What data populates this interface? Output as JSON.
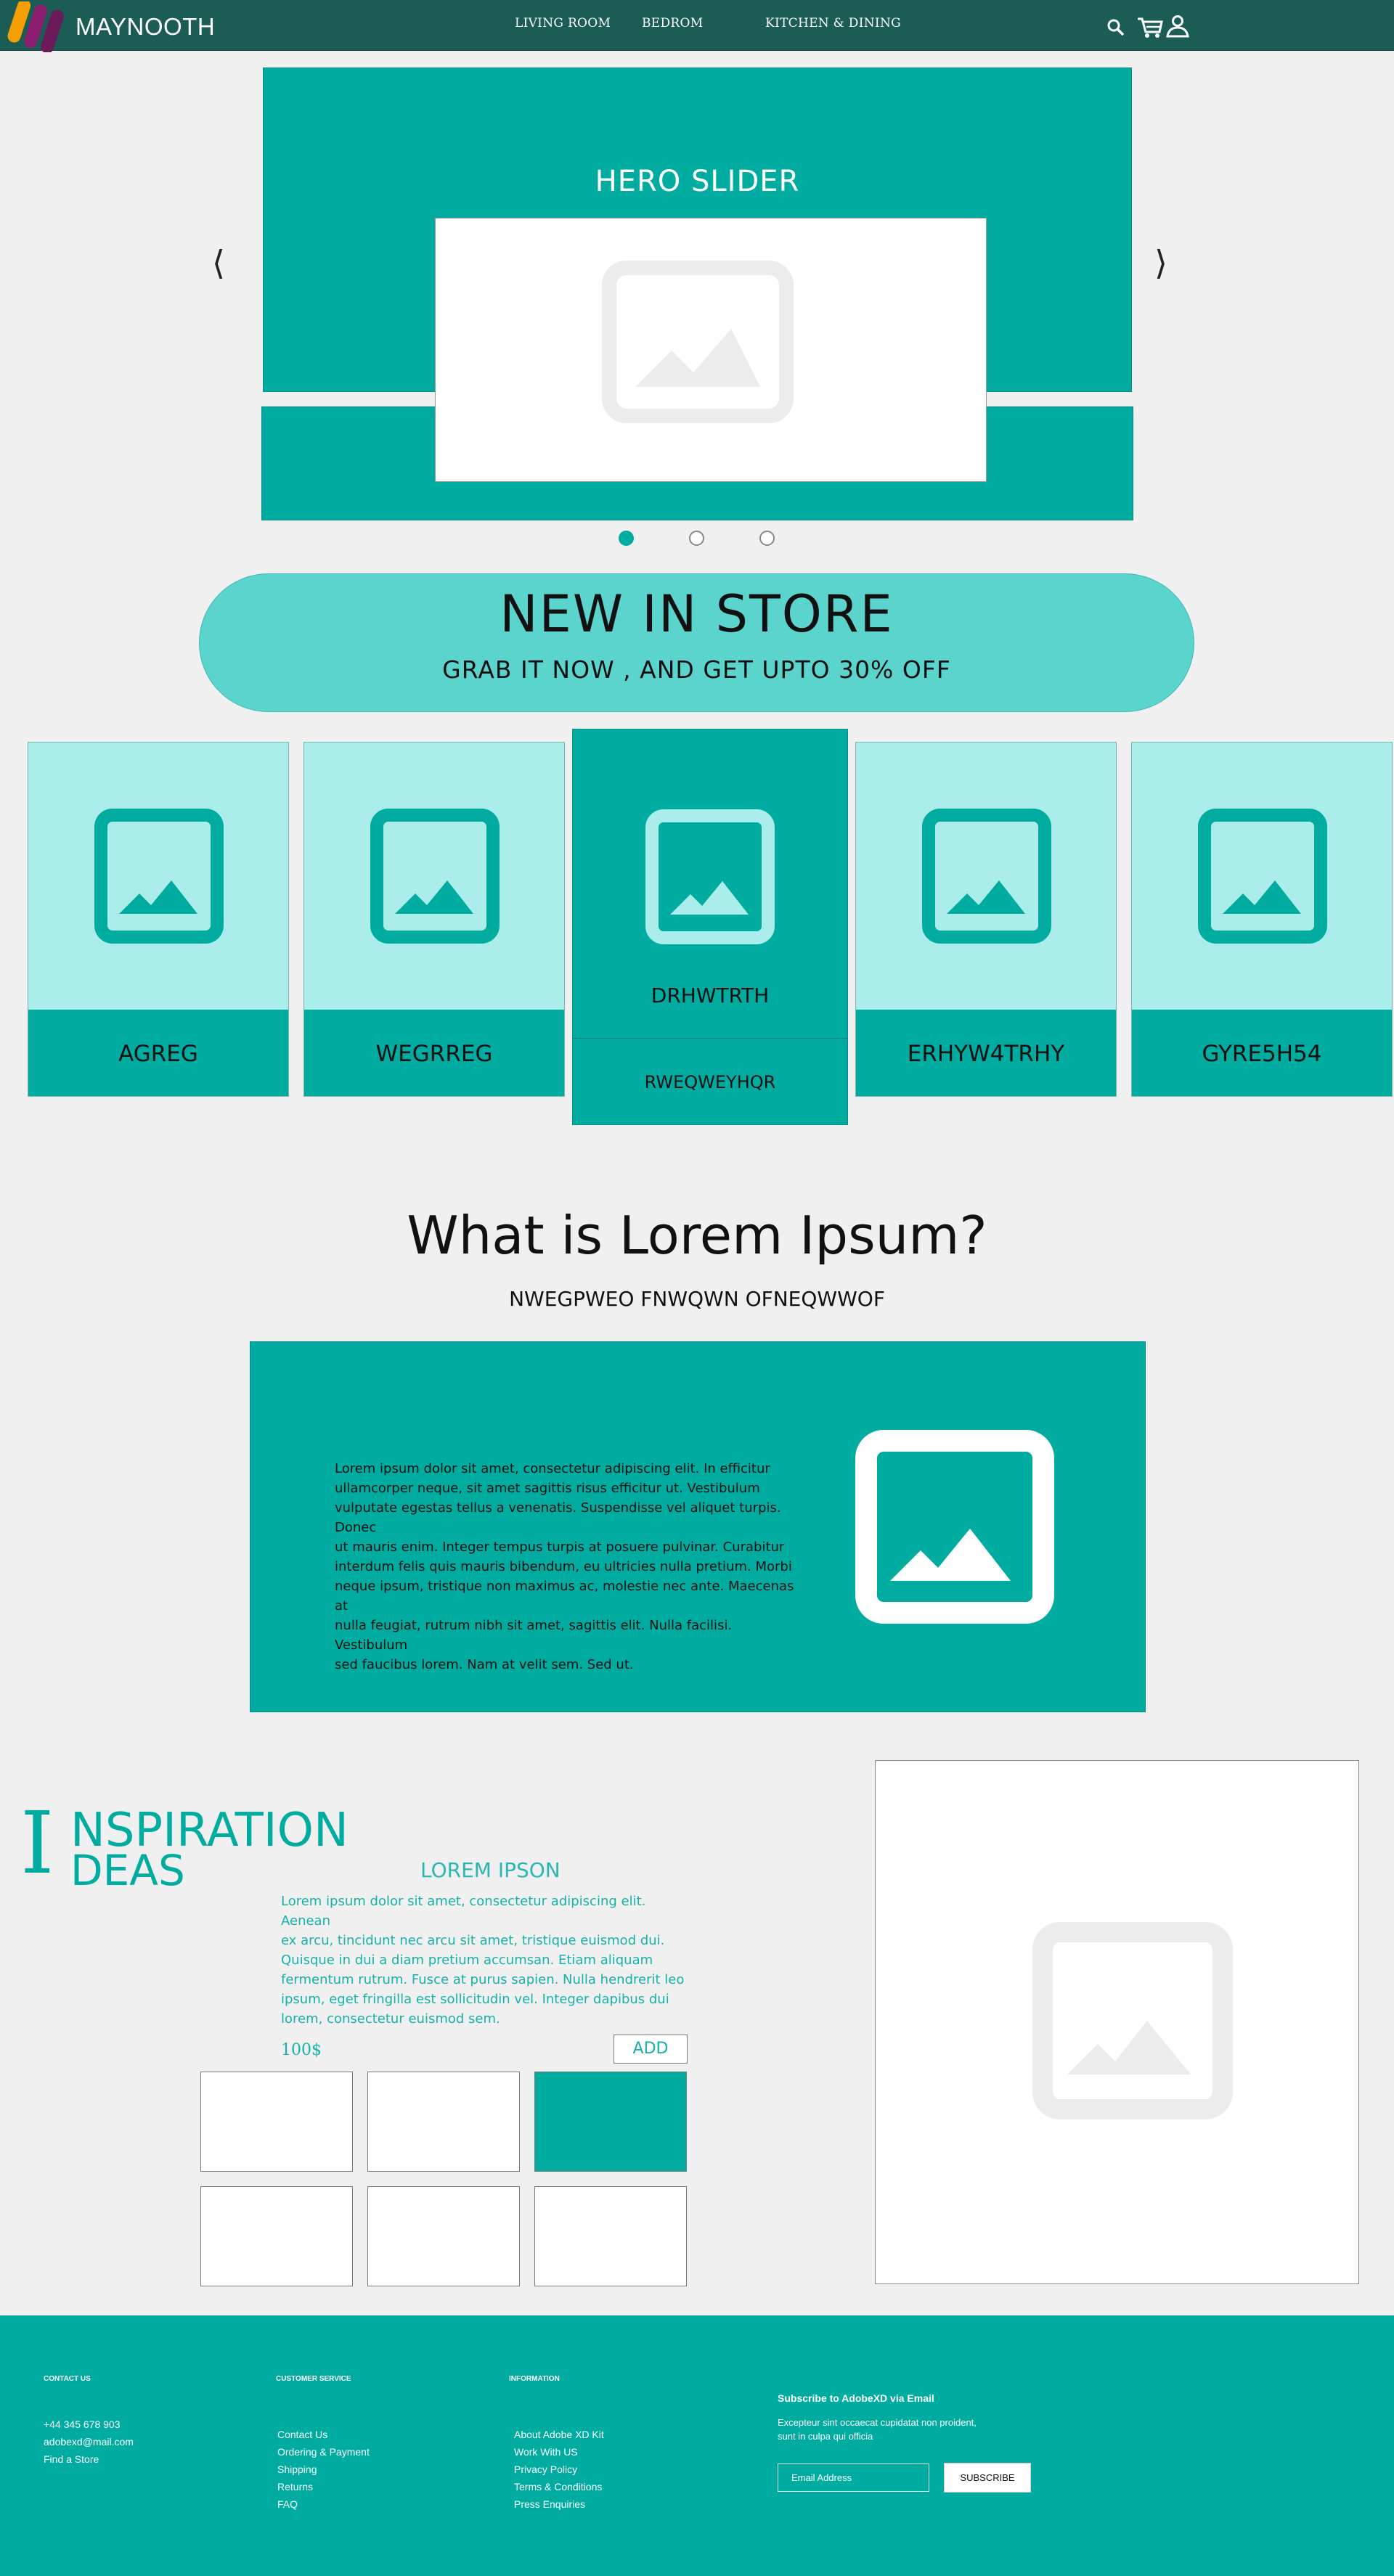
{
  "header": {
    "brand": "MAYNOOTH",
    "nav": [
      "LIVING ROOM",
      "BEDROM",
      "KITCHEN & DINING"
    ],
    "icons": [
      "search-icon",
      "cart-icon",
      "user-icon"
    ]
  },
  "hero": {
    "title": "HERO SLIDER",
    "prev": "⟨",
    "next": "⟩",
    "active_slide": 1,
    "slide_count": 3
  },
  "promo": {
    "title": "NEW IN STORE",
    "subtitle": "GRAB IT NOW , AND GET UPTO 30% OFF"
  },
  "products": [
    {
      "label": "AGREG"
    },
    {
      "label": "WEGRREG"
    },
    {
      "label": "DRHWTRTH",
      "sub": "RWEQWEYHQR",
      "featured": true
    },
    {
      "label": "ERHYW4TRHY"
    },
    {
      "label": "GYRE5H54"
    }
  ],
  "lorem": {
    "title": "What is Lorem Ipsum?",
    "subtitle": "NWEGPWEO FNWQWN OFNEQWWOF",
    "lines": [
      "Lorem ipsum dolor sit amet, consectetur adipiscing elit. In efficitur",
      "ullamcorper neque, sit amet sagittis risus efficitur ut. Vestibulum",
      "vulputate egestas tellus a venenatis. Suspendisse vel aliquet turpis. Donec",
      "ut mauris enim. Integer tempus turpis at posuere pulvinar. Curabitur",
      "interdum felis quis mauris bibendum, eu ultricies nulla pretium. Morbi",
      "neque ipsum, tristique non maximus ac, molestie nec ante. Maecenas at",
      "nulla feugiat, rutrum nibh sit amet, sagittis elit. Nulla facilisi. Vestibulum",
      "sed faucibus lorem. Nam at velit sem. Sed ut."
    ]
  },
  "inspiration": {
    "initial": "I",
    "line1": "NSPIRATION",
    "line2": "DEAS",
    "heading": "LOREM IPSON",
    "lines": [
      "Lorem ipsum dolor sit amet, consectetur adipiscing elit. Aenean",
      "ex arcu, tincidunt nec arcu sit amet, tristique euismod dui.",
      "Quisque in dui a diam pretium accumsan. Etiam aliquam",
      "fermentum rutrum. Fusce at purus sapien. Nulla hendrerit leo",
      "ipsum, eget fringilla est sollicitudin vel. Integer dapibus dui",
      "lorem, consectetur euismod sem."
    ],
    "price": "100$",
    "add": "ADD"
  },
  "footer": {
    "contact": {
      "title": "CONTACT US",
      "items": [
        "+44 345 678 903",
        "adobexd@mail.com",
        "Find a Store"
      ]
    },
    "service": {
      "title": "CUSTOMER SERVICE",
      "items": [
        "Contact Us",
        "Ordering & Payment",
        "Shipping",
        "Returns",
        "FAQ"
      ]
    },
    "info": {
      "title": "INFORMATION",
      "items": [
        "About Adobe XD Kit",
        "Work With US",
        "Privacy Policy",
        "Terms & Conditions",
        "Press Enquiries"
      ]
    },
    "subscribe": {
      "title": "Subscribe to AdobeXD via Email",
      "text": "Excepteur sint occaecat cupidatat non proident, sunt in culpa qui officia",
      "placeholder": "Email Address",
      "button": "SUBSCRIBE"
    }
  },
  "colors": {
    "teal": "#00aba0",
    "dark_teal": "#1b5c54",
    "light_teal": "#aaedea",
    "promo": "#5bd4cd"
  }
}
